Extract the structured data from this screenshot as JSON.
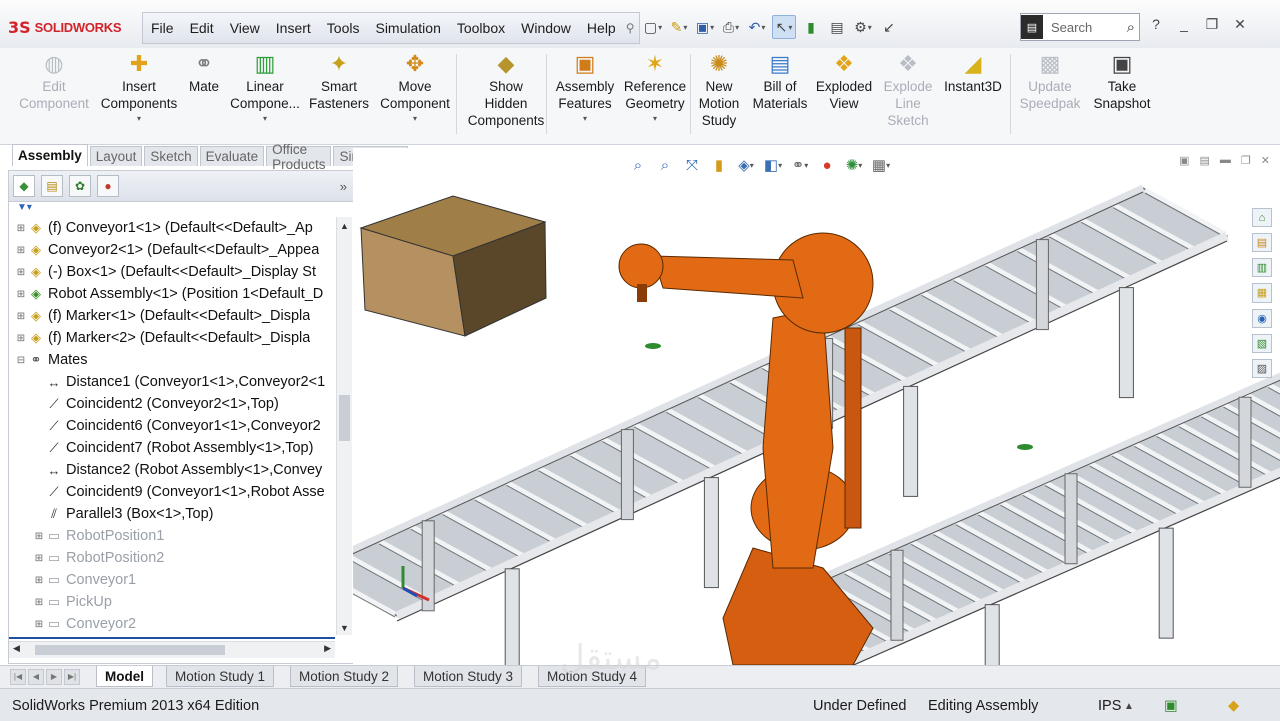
{
  "app": {
    "logo_text": "SOLIDWORKS",
    "logo_mark": "3S"
  },
  "menubar": {
    "items": [
      "File",
      "Edit",
      "View",
      "Insert",
      "Tools",
      "Simulation",
      "Toolbox",
      "Window",
      "Help"
    ]
  },
  "quick_access": {
    "icons": [
      "new-document-icon",
      "open-icon",
      "save-icon",
      "print-icon",
      "undo-icon",
      "select-icon",
      "rebuild-icon",
      "file-properties-icon",
      "options-icon"
    ]
  },
  "search": {
    "placeholder": "Search"
  },
  "ribbon": {
    "commands": [
      {
        "id": "edit-component",
        "label_lines": [
          "Edit",
          "Component"
        ],
        "enabled": false,
        "icon": "edit-component-icon"
      },
      {
        "id": "insert-components",
        "label_lines": [
          "Insert",
          "Components"
        ],
        "enabled": true,
        "icon": "insert-components-icon"
      },
      {
        "id": "mate",
        "label_lines": [
          "Mate"
        ],
        "enabled": true,
        "icon": "mate-paperclip-icon"
      },
      {
        "id": "linear-component",
        "label_lines": [
          "Linear",
          "Compone..."
        ],
        "enabled": true,
        "icon": "linear-pattern-icon"
      },
      {
        "id": "smart-fasteners",
        "label_lines": [
          "Smart",
          "Fasteners"
        ],
        "enabled": true,
        "icon": "smart-fasteners-icon"
      },
      {
        "id": "move-component",
        "label_lines": [
          "Move",
          "Component"
        ],
        "enabled": true,
        "icon": "move-component-icon"
      },
      {
        "id": "show-hidden-components",
        "label_lines": [
          "Show",
          "Hidden",
          "Components"
        ],
        "enabled": true,
        "icon": "show-hidden-icon"
      },
      {
        "id": "assembly-features",
        "label_lines": [
          "Assembly",
          "Features"
        ],
        "enabled": true,
        "icon": "assembly-features-icon"
      },
      {
        "id": "reference-geometry",
        "label_lines": [
          "Reference",
          "Geometry"
        ],
        "enabled": true,
        "icon": "reference-geometry-icon"
      },
      {
        "id": "new-motion-study",
        "label_lines": [
          "New",
          "Motion",
          "Study"
        ],
        "enabled": true,
        "icon": "motion-study-icon"
      },
      {
        "id": "bill-of-materials",
        "label_lines": [
          "Bill of",
          "Materials"
        ],
        "enabled": true,
        "icon": "bom-icon"
      },
      {
        "id": "exploded-view",
        "label_lines": [
          "Exploded",
          "View"
        ],
        "enabled": true,
        "icon": "exploded-view-icon"
      },
      {
        "id": "explode-line-sketch",
        "label_lines": [
          "Explode",
          "Line",
          "Sketch"
        ],
        "enabled": false,
        "icon": "explode-line-icon"
      },
      {
        "id": "instant3d",
        "label_lines": [
          "Instant3D"
        ],
        "enabled": true,
        "icon": "instant3d-icon"
      },
      {
        "id": "update-speedpak",
        "label_lines": [
          "Update",
          "Speedpak"
        ],
        "enabled": false,
        "icon": "speedpak-icon"
      },
      {
        "id": "take-snapshot",
        "label_lines": [
          "Take",
          "Snapshot"
        ],
        "enabled": true,
        "icon": "snapshot-icon"
      }
    ]
  },
  "command_tabs": {
    "tabs": [
      "Assembly",
      "Layout",
      "Sketch",
      "Evaluate",
      "Office Products",
      "Simulation"
    ],
    "active": "Assembly"
  },
  "feature_tree": {
    "items": [
      {
        "label": "(f) Conveyor1<1> (Default<<Default>_Ap",
        "icon": "part-icon",
        "expand": "+",
        "indent": 0,
        "greyed": false
      },
      {
        "label": "Conveyor2<1> (Default<<Default>_Appea",
        "icon": "part-icon",
        "expand": "+",
        "indent": 0,
        "greyed": false
      },
      {
        "label": "(-) Box<1> (Default<<Default>_Display St",
        "icon": "part-icon",
        "expand": "+",
        "indent": 0,
        "greyed": false
      },
      {
        "label": "Robot Assembly<1> (Position 1<Default_D",
        "icon": "subassembly-icon",
        "expand": "+",
        "indent": 0,
        "greyed": false
      },
      {
        "label": "(f) Marker<1> (Default<<Default>_Displa",
        "icon": "part-icon",
        "expand": "+",
        "indent": 0,
        "greyed": false
      },
      {
        "label": "(f) Marker<2> (Default<<Default>_Displa",
        "icon": "part-icon",
        "expand": "+",
        "indent": 0,
        "greyed": false
      },
      {
        "label": "Mates",
        "icon": "mates-folder-icon",
        "expand": "-",
        "indent": 0,
        "greyed": false
      },
      {
        "label": "Distance1 (Conveyor1<1>,Conveyor2<1",
        "icon": "distance-mate-icon",
        "expand": "",
        "indent": 1,
        "greyed": false
      },
      {
        "label": "Coincident2 (Conveyor2<1>,Top)",
        "icon": "coincident-mate-icon",
        "expand": "",
        "indent": 1,
        "greyed": false
      },
      {
        "label": "Coincident6 (Conveyor1<1>,Conveyor2",
        "icon": "coincident-mate-icon",
        "expand": "",
        "indent": 1,
        "greyed": false
      },
      {
        "label": "Coincident7 (Robot Assembly<1>,Top)",
        "icon": "coincident-mate-icon",
        "expand": "",
        "indent": 1,
        "greyed": false
      },
      {
        "label": "Distance2 (Robot Assembly<1>,Convey",
        "icon": "distance-mate-icon",
        "expand": "",
        "indent": 1,
        "greyed": false
      },
      {
        "label": "Coincident9 (Conveyor1<1>,Robot Asse",
        "icon": "coincident-mate-icon",
        "expand": "",
        "indent": 1,
        "greyed": false
      },
      {
        "label": "Parallel3 (Box<1>,Top)",
        "icon": "parallel-mate-icon",
        "expand": "",
        "indent": 1,
        "greyed": false
      },
      {
        "label": "RobotPosition1",
        "icon": "folder-icon",
        "expand": "+",
        "indent": 1,
        "greyed": true
      },
      {
        "label": "RobotPosition2",
        "icon": "folder-icon",
        "expand": "+",
        "indent": 1,
        "greyed": true
      },
      {
        "label": "Conveyor1",
        "icon": "folder-icon",
        "expand": "+",
        "indent": 1,
        "greyed": true
      },
      {
        "label": "PickUp",
        "icon": "folder-icon",
        "expand": "+",
        "indent": 1,
        "greyed": true
      },
      {
        "label": "Conveyor2",
        "icon": "folder-icon",
        "expand": "+",
        "indent": 1,
        "greyed": true
      }
    ]
  },
  "bottom_tabs": {
    "tabs": [
      "Model",
      "Motion Study 1",
      "Motion Study 2",
      "Motion Study 3",
      "Motion Study 4"
    ],
    "active": "Model"
  },
  "status": {
    "edition": "SolidWorks Premium 2013 x64 Edition",
    "definition": "Under Defined",
    "mode": "Editing Assembly",
    "units": "IPS"
  },
  "watermark": "مستقل",
  "colors": {
    "robot": "#e26a14",
    "box": "#b08d5a",
    "conveyor": "#d9dde2",
    "accent": "#d2232a"
  }
}
